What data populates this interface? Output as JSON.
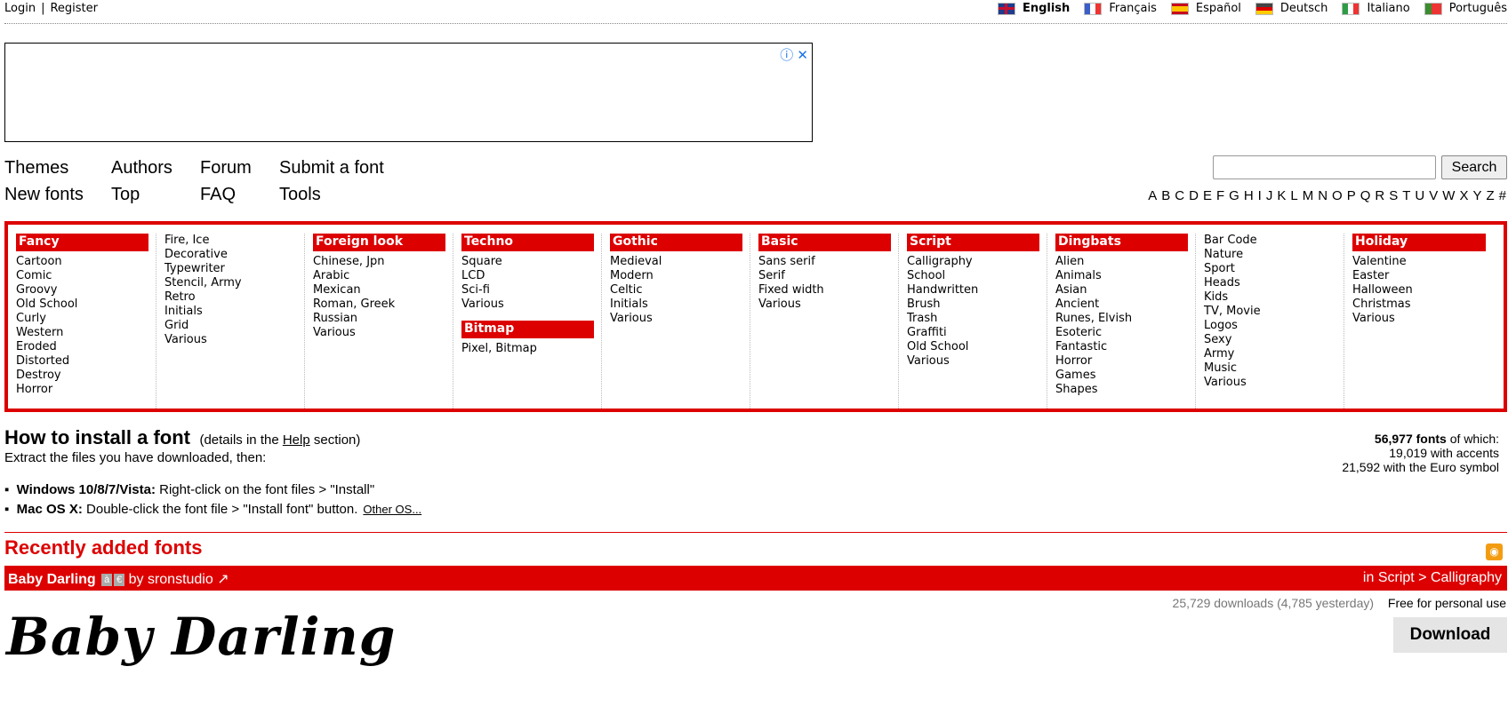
{
  "topbar": {
    "login": "Login",
    "separator": "|",
    "register": "Register",
    "languages": [
      {
        "label": "English",
        "active": true,
        "flag_color": "#1f3b8c"
      },
      {
        "label": "Français",
        "active": false,
        "flag_color": "#3b5ec9"
      },
      {
        "label": "Español",
        "active": false,
        "flag_color": "#e8b400"
      },
      {
        "label": "Deutsch",
        "active": false,
        "flag_color": "#444444"
      },
      {
        "label": "Italiano",
        "active": false,
        "flag_color": "#2e9c45"
      },
      {
        "label": "Português",
        "active": false,
        "flag_color": "#3a8c2e"
      }
    ]
  },
  "ad": {
    "info_icon": "ⓘ",
    "close_icon": "✕"
  },
  "nav": {
    "themes": "Themes",
    "authors": "Authors",
    "forum": "Forum",
    "submit": "Submit a font",
    "new_fonts": "New fonts",
    "top": "Top",
    "faq": "FAQ",
    "tools": "Tools"
  },
  "search": {
    "placeholder": "",
    "button": "Search"
  },
  "alphabet": [
    "A",
    "B",
    "C",
    "D",
    "E",
    "F",
    "G",
    "H",
    "I",
    "J",
    "K",
    "L",
    "M",
    "N",
    "O",
    "P",
    "Q",
    "R",
    "S",
    "T",
    "U",
    "V",
    "W",
    "X",
    "Y",
    "Z",
    "#"
  ],
  "categories": {
    "fancy": {
      "title": "Fancy",
      "items": [
        "Cartoon",
        "Comic",
        "Groovy",
        "Old School",
        "Curly",
        "Western",
        "Eroded",
        "Distorted",
        "Destroy",
        "Horror"
      ]
    },
    "fancy2": {
      "items": [
        "Fire, Ice",
        "Decorative",
        "Typewriter",
        "Stencil, Army",
        "Retro",
        "Initials",
        "Grid",
        "Various"
      ]
    },
    "foreign": {
      "title": "Foreign look",
      "items": [
        "Chinese, Jpn",
        "Arabic",
        "Mexican",
        "Roman, Greek",
        "Russian",
        "Various"
      ]
    },
    "techno": {
      "title": "Techno",
      "items": [
        "Square",
        "LCD",
        "Sci-fi",
        "Various"
      ]
    },
    "bitmap": {
      "title": "Bitmap",
      "items": [
        "Pixel, Bitmap"
      ]
    },
    "gothic": {
      "title": "Gothic",
      "items": [
        "Medieval",
        "Modern",
        "Celtic",
        "Initials",
        "Various"
      ]
    },
    "basic": {
      "title": "Basic",
      "items": [
        "Sans serif",
        "Serif",
        "Fixed width",
        "Various"
      ]
    },
    "script": {
      "title": "Script",
      "items": [
        "Calligraphy",
        "School",
        "Handwritten",
        "Brush",
        "Trash",
        "Graffiti",
        "Old School",
        "Various"
      ]
    },
    "dingbats": {
      "title": "Dingbats",
      "items": [
        "Alien",
        "Animals",
        "Asian",
        "Ancient",
        "Runes, Elvish",
        "Esoteric",
        "Fantastic",
        "Horror",
        "Games",
        "Shapes"
      ]
    },
    "dingbats2": {
      "items": [
        "Bar Code",
        "Nature",
        "Sport",
        "Heads",
        "Kids",
        "TV, Movie",
        "Logos",
        "Sexy",
        "Army",
        "Music",
        "Various"
      ]
    },
    "holiday": {
      "title": "Holiday",
      "items": [
        "Valentine",
        "Easter",
        "Halloween",
        "Christmas",
        "Various"
      ]
    }
  },
  "howto": {
    "title": "How to install a font",
    "details_prefix": "(details in the",
    "details_link": "Help",
    "details_suffix": "section)",
    "extract": "Extract the files you have downloaded, then:",
    "windows_label": "Windows 10/8/7/Vista:",
    "windows_text": "Right-click on the font files > \"Install\"",
    "mac_label": "Mac OS X:",
    "mac_text": "Double-click the font file > \"Install font\" button.",
    "other_os": "Other OS..."
  },
  "stats": {
    "total": "56,977 fonts",
    "total_suffix": "of which:",
    "accents": "19,019 with accents",
    "euro": "21,592 with the Euro symbol"
  },
  "recent": {
    "title": "Recently added fonts",
    "rss_icon": "rss-icon"
  },
  "font": {
    "name": "Baby Darling",
    "badge1": "à",
    "badge2": "€",
    "by": "by sronstudio",
    "category": "in Script > Calligraphy",
    "downloads": "25,729 downloads (4,785 yesterday)",
    "license": "Free for personal use",
    "download_button": "Download",
    "preview": "Baby Darling"
  },
  "colors": {
    "accent": "#dd0000",
    "text": "#000000",
    "muted": "#777777"
  }
}
